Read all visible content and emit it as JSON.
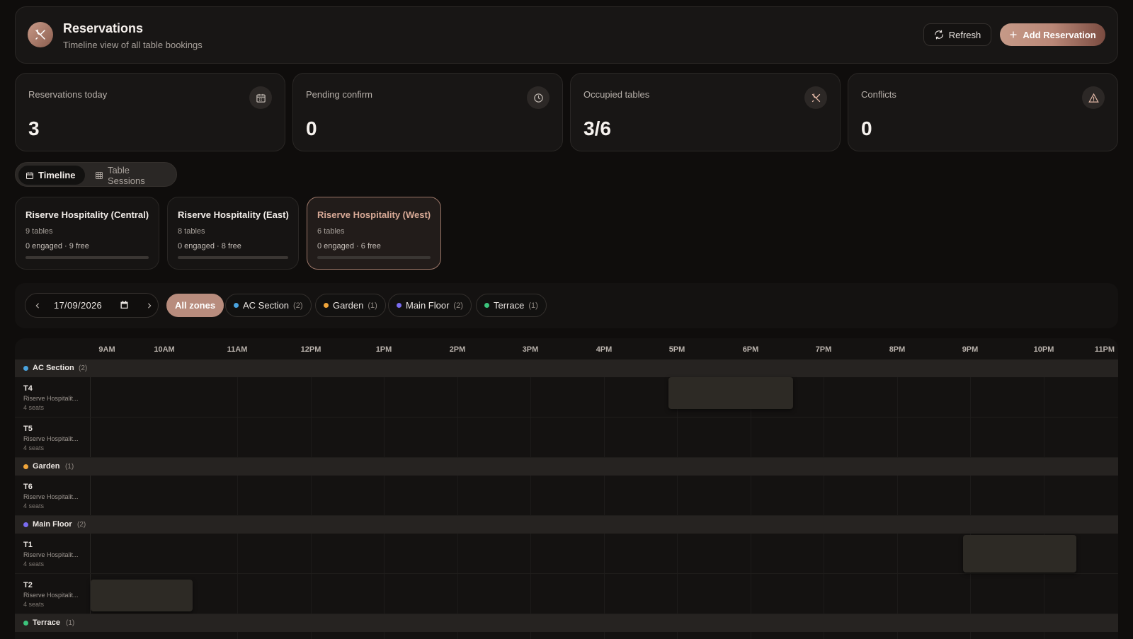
{
  "header": {
    "title": "Reservations",
    "subtitle": "Timeline view of all table bookings",
    "refresh_label": "Refresh",
    "add_label": "Add Reservation"
  },
  "stats": [
    {
      "label": "Reservations today",
      "value": "3",
      "icon": "calendar-icon"
    },
    {
      "label": "Pending confirm",
      "value": "0",
      "icon": "clock-icon"
    },
    {
      "label": "Occupied tables",
      "value": "3/6",
      "icon": "utensils-icon"
    },
    {
      "label": "Conflicts",
      "value": "0",
      "icon": "warning-icon"
    }
  ],
  "view_toggle": {
    "timeline": "Timeline",
    "sessions": "Table Sessions"
  },
  "locations": [
    {
      "name": "Riserve Hospitality (Central)",
      "tables": "9 tables",
      "engaged": "0 engaged · 9 free"
    },
    {
      "name": "Riserve Hospitality (East)",
      "tables": "8 tables",
      "engaged": "0 engaged · 8 free"
    },
    {
      "name": "Riserve Hospitality (West)",
      "tables": "6 tables",
      "engaged": "0 engaged · 6 free",
      "selected": true
    }
  ],
  "filters": {
    "date": "17/09/2026",
    "all_zones": "All zones",
    "zones": [
      {
        "name": "AC Section",
        "count": "(2)",
        "color": "#4aa3df"
      },
      {
        "name": "Garden",
        "count": "(1)",
        "color": "#f0a53a"
      },
      {
        "name": "Main Floor",
        "count": "(2)",
        "color": "#7a6cf0"
      },
      {
        "name": "Terrace",
        "count": "(1)",
        "color": "#3cc47c"
      }
    ]
  },
  "timeline": {
    "hours": [
      "9AM",
      "10AM",
      "11AM",
      "12PM",
      "1PM",
      "2PM",
      "3PM",
      "4PM",
      "5PM",
      "6PM",
      "7PM",
      "8PM",
      "9PM",
      "10PM",
      "11PM"
    ],
    "groups": {
      "ac": {
        "name": "AC Section",
        "count": "(2)",
        "color": "#4aa3df"
      },
      "garden": {
        "name": "Garden",
        "count": "(1)",
        "color": "#f0a53a"
      },
      "main": {
        "name": "Main Floor",
        "count": "(2)",
        "color": "#7a6cf0"
      },
      "terrace": {
        "name": "Terrace",
        "count": "(1)",
        "color": "#3cc47c"
      }
    },
    "tables": {
      "t4": {
        "name": "T4",
        "location": "Riserve Hospitalit...",
        "seats": "4 seats"
      },
      "t5": {
        "name": "T5",
        "location": "Riserve Hospitalit...",
        "seats": "4 seats"
      },
      "t6": {
        "name": "T6",
        "location": "Riserve Hospitalit...",
        "seats": "4 seats"
      },
      "t1": {
        "name": "T1",
        "location": "Riserve Hospitalit...",
        "seats": "4 seats"
      },
      "t2": {
        "name": "T2",
        "location": "Riserve Hospitalit...",
        "seats": "4 seats"
      }
    }
  }
}
